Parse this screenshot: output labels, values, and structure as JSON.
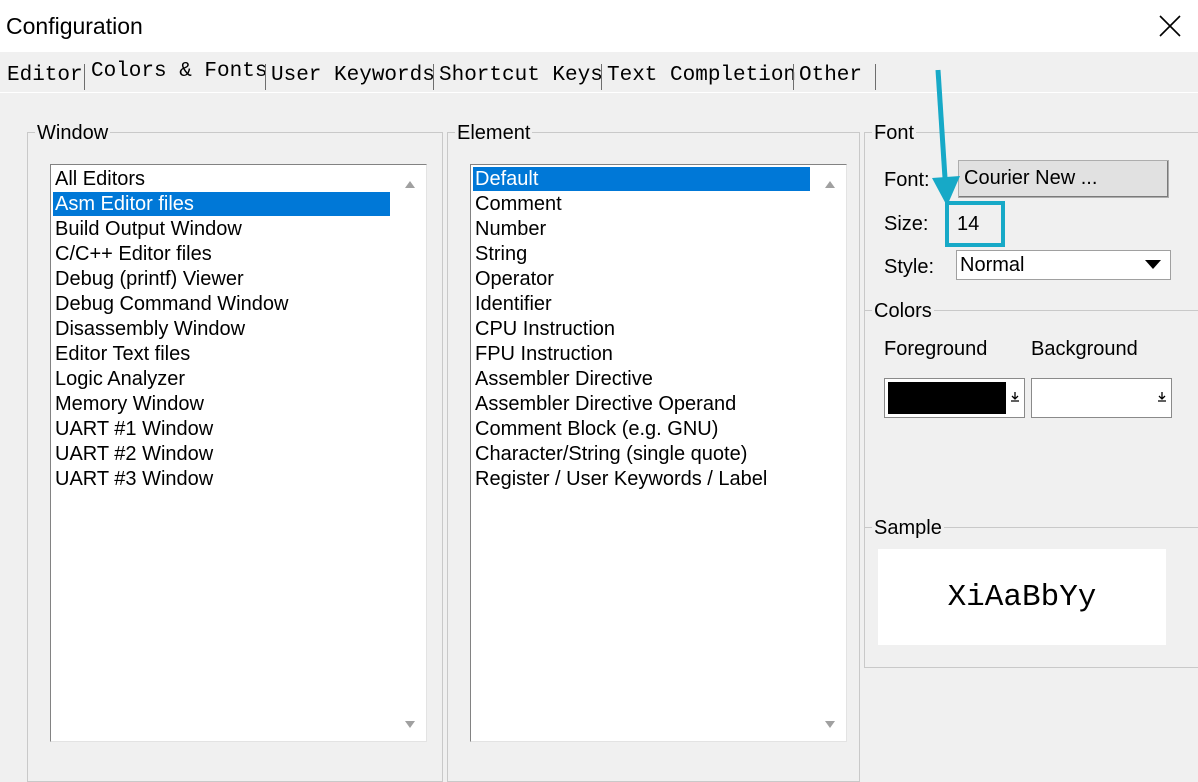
{
  "window": {
    "title": "Configuration"
  },
  "tabs": [
    "Editor",
    "Colors & Fonts",
    "User Keywords",
    "Shortcut Keys",
    "Text Completion",
    "Other"
  ],
  "active_tab": "Colors & Fonts",
  "window_group": {
    "label": "Window",
    "items": [
      "All Editors",
      "Asm Editor files",
      "Build Output Window",
      "C/C++ Editor files",
      "Debug (printf) Viewer",
      "Debug Command Window",
      "Disassembly Window",
      "Editor Text files",
      "Logic Analyzer",
      "Memory Window",
      "UART #1 Window",
      "UART #2 Window",
      "UART #3 Window"
    ],
    "selected": "Asm Editor files"
  },
  "element_group": {
    "label": "Element",
    "items": [
      "Default",
      "Comment",
      "Number",
      "String",
      "Operator",
      "Identifier",
      "CPU Instruction",
      "FPU Instruction",
      "Assembler Directive",
      "Assembler Directive Operand",
      "Comment Block (e.g. GNU)",
      "Character/String (single quote)",
      "Register / User Keywords / Label"
    ],
    "selected": "Default"
  },
  "font_group": {
    "label": "Font",
    "font_label": "Font:",
    "font_button": "Courier New ...",
    "size_label": "Size:",
    "size_value": "14",
    "style_label": "Style:",
    "style_value": "Normal"
  },
  "colors_group": {
    "label": "Colors",
    "foreground_label": "Foreground",
    "background_label": "Background",
    "foreground_color": "#000000",
    "background_color": "#ffffff"
  },
  "sample_group": {
    "label": "Sample",
    "text": "XiAaBbYy"
  },
  "annotation_color": "#17a9c7",
  "selection_color": "#0078d7"
}
